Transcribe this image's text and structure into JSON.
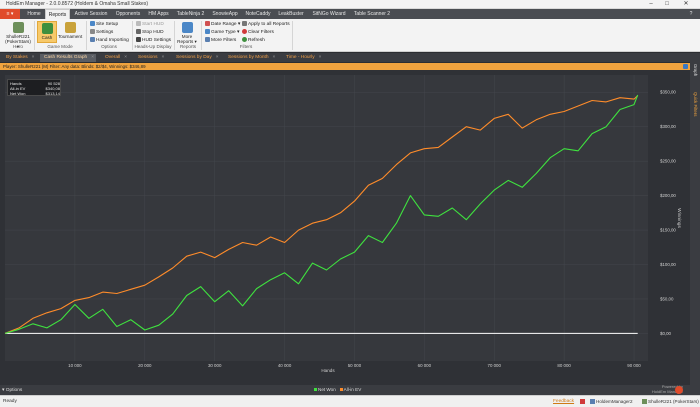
{
  "window": {
    "title": "HoldEm Manager - 2.0.0.8572 (Holdem & Omaha Small Stakes)",
    "controls": [
      "–",
      "□",
      "✕"
    ]
  },
  "menubar": {
    "file_label": "≡ ▾",
    "items": [
      "Home",
      "Reports",
      "Active Session",
      "Opponents",
      "HM Apps",
      "TableNinja 2",
      "SnowieApp",
      "NoteCaddy",
      "LeakBuster",
      "SitNGo Wizard",
      "Table Scanner 2"
    ],
    "active": "Reports",
    "help": "?"
  },
  "ribbon": {
    "hero": {
      "label": "ShulleR221 (PokerStars) ▾"
    },
    "game_mode": {
      "cash": "Cash",
      "tournament": "Tournament"
    },
    "options": {
      "site_setup": "Site Setup",
      "settings": "Settings",
      "hand_importing": "Hand Importing"
    },
    "hud": {
      "start": "Start HUD",
      "stop": "Stop HUD",
      "settings": "HUD Settings"
    },
    "reports": {
      "more": "More Reports ▾"
    },
    "filters": {
      "date_range": "Date Range ▾",
      "game_type": "Game Type ▾",
      "more_filters": "More Filters",
      "apply_all": "Apply to all Reports",
      "clear": "Clear Filters",
      "refresh": "Refresh"
    },
    "groups": [
      "Hero",
      "Game Mode",
      "Options",
      "Heads-Up Display",
      "Reports",
      "Filters"
    ]
  },
  "tabs": [
    {
      "label": "By Stakes"
    },
    {
      "label": "Cash Results Graph"
    },
    {
      "label": "Overall"
    },
    {
      "label": "Sessions"
    },
    {
      "label": "Sessions by Day"
    },
    {
      "label": "Sessions by Month"
    },
    {
      "label": "Time - Hourly"
    }
  ],
  "filter_bar": "Player: ShulleR221 (M)  Filter: Any data: Blinds: $2/$4, Winnings: $346,89",
  "right_rail": {
    "graph": "Graph",
    "quick_filters": "Quick Filters"
  },
  "stats": [
    {
      "label": "Hands",
      "value": "90 528"
    },
    {
      "label": "All-in EV",
      "value": "$340,08"
    },
    {
      "label": "Net Won",
      "value": "$313,14"
    }
  ],
  "chart_data": {
    "type": "line",
    "xlabel": "Hands",
    "ylabel": "Winnings",
    "xlim": [
      0,
      92000
    ],
    "ylim": [
      -40,
      375
    ],
    "x_ticks": [
      "10 000",
      "20 000",
      "30 000",
      "40 000",
      "50 000",
      "60 000",
      "70 000",
      "80 000",
      "90 000"
    ],
    "y_ticks": [
      "$0,00",
      "$50,00",
      "$100,00",
      "$150,00",
      "$200,00",
      "$250,00",
      "$300,00",
      "$350,00"
    ],
    "grid": true,
    "legend": "bottom-center",
    "colors": {
      "net_won": "#3fe23f",
      "all_in_ev": "#ff8c2a",
      "zero": "#ffffff"
    },
    "series": [
      {
        "name": "Net Won",
        "x": [
          0,
          2000,
          4000,
          6000,
          8000,
          10000,
          12000,
          14000,
          16000,
          18000,
          20000,
          22000,
          24000,
          26000,
          28000,
          30000,
          32000,
          34000,
          36000,
          38000,
          40000,
          42000,
          44000,
          46000,
          48000,
          50000,
          52000,
          54000,
          56000,
          58000,
          60000,
          62000,
          64000,
          66000,
          68000,
          70000,
          72000,
          74000,
          76000,
          78000,
          80000,
          82000,
          84000,
          86000,
          88000,
          90000,
          90528
        ],
        "values": [
          0,
          6,
          14,
          8,
          20,
          42,
          22,
          35,
          10,
          20,
          5,
          12,
          28,
          55,
          68,
          46,
          62,
          40,
          65,
          78,
          88,
          72,
          102,
          92,
          108,
          118,
          142,
          132,
          160,
          200,
          172,
          170,
          182,
          165,
          188,
          208,
          222,
          212,
          232,
          255,
          268,
          265,
          290,
          300,
          325,
          332,
          346
        ]
      },
      {
        "name": "All-in EV",
        "x": [
          0,
          2000,
          4000,
          6000,
          8000,
          10000,
          12000,
          14000,
          16000,
          18000,
          20000,
          22000,
          24000,
          26000,
          28000,
          30000,
          32000,
          34000,
          36000,
          38000,
          40000,
          42000,
          44000,
          46000,
          48000,
          50000,
          52000,
          54000,
          56000,
          58000,
          60000,
          62000,
          64000,
          66000,
          68000,
          70000,
          72000,
          74000,
          76000,
          78000,
          80000,
          82000,
          84000,
          86000,
          88000,
          90000,
          90528
        ],
        "values": [
          0,
          8,
          22,
          30,
          36,
          48,
          52,
          60,
          58,
          64,
          70,
          82,
          95,
          112,
          118,
          110,
          122,
          132,
          128,
          140,
          132,
          150,
          160,
          165,
          175,
          192,
          215,
          225,
          245,
          262,
          268,
          270,
          285,
          300,
          295,
          312,
          318,
          298,
          310,
          318,
          322,
          330,
          338,
          336,
          342,
          340,
          345
        ]
      }
    ]
  },
  "bottom": {
    "options": "Options",
    "legend": [
      "Net Won",
      "All-in EV"
    ],
    "powered_by": "Powered by",
    "powered_name": "HoldEm Manager"
  },
  "status": {
    "ready": "Ready",
    "feedback": "Feedback",
    "item1": "HoldemManager2",
    "item2": "ShulleR221 (PokerStars)"
  }
}
